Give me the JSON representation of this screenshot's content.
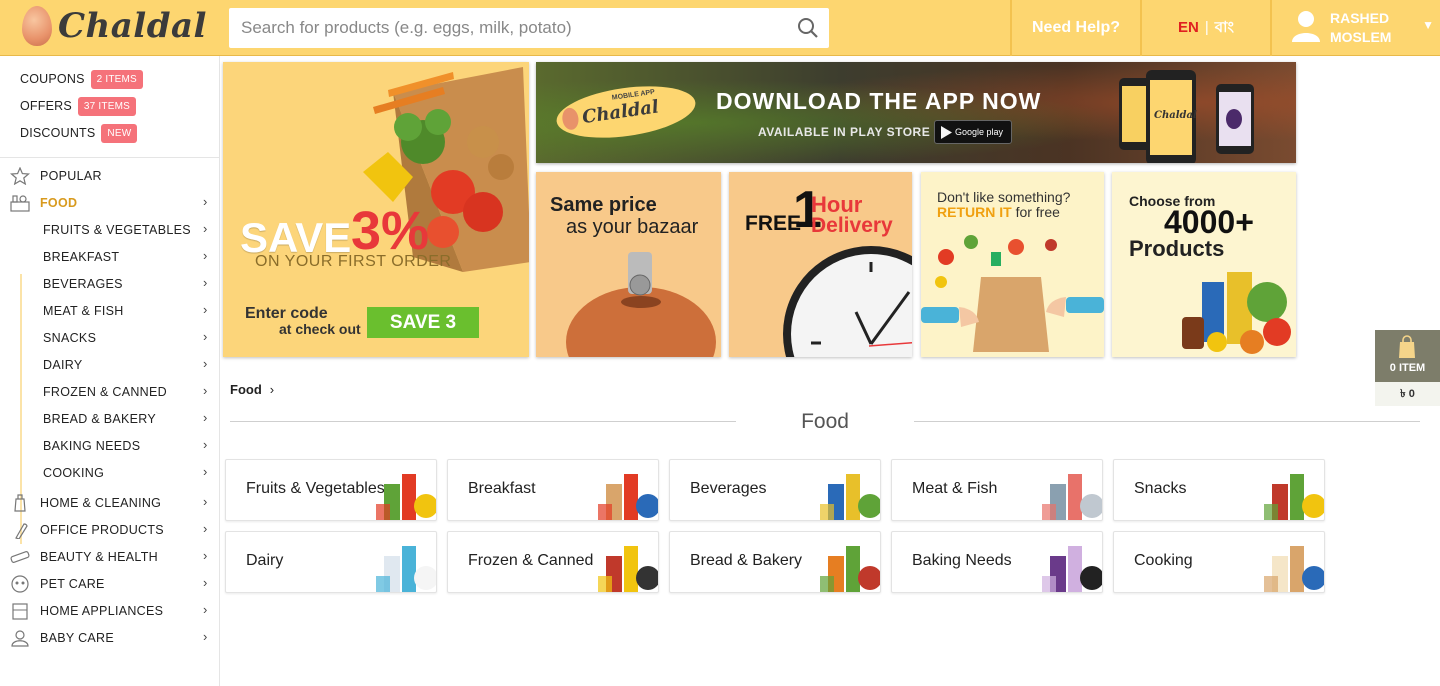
{
  "header": {
    "logo_text": "Chaldal",
    "search_placeholder": "Search for products (e.g. eggs, milk, potato)",
    "help_label": "Need Help?",
    "lang_en": "EN",
    "lang_sep": "|",
    "lang_bn": "বাং",
    "user_first": "RASHED",
    "user_last": "MOSLEM"
  },
  "sidebar": {
    "promos": [
      {
        "label": "COUPONS",
        "badge": "2 ITEMS"
      },
      {
        "label": "OFFERS",
        "badge": "37 ITEMS"
      },
      {
        "label": "DISCOUNTS",
        "badge": "NEW"
      }
    ],
    "popular": "POPULAR",
    "food": "FOOD",
    "food_sub": [
      "FRUITS & VEGETABLES",
      "BREAKFAST",
      "BEVERAGES",
      "MEAT & FISH",
      "SNACKS",
      "DAIRY",
      "FROZEN & CANNED",
      "BREAD & BAKERY",
      "BAKING NEEDS",
      "COOKING"
    ],
    "others": [
      "HOME & CLEANING",
      "OFFICE PRODUCTS",
      "BEAUTY & HEALTH",
      "PET CARE",
      "HOME APPLIANCES",
      "BABY CARE"
    ]
  },
  "banners": {
    "save": {
      "big": "SAVE",
      "pct": "3%",
      "sub": "ON YOUR FIRST ORDER",
      "code_line1": "Enter code",
      "code_line2": "at check out",
      "code": "SAVE 3"
    },
    "app": {
      "badge_top": "MOBILE APP",
      "badge_name": "Chaldal",
      "headline": "DOWNLOAD THE APP NOW",
      "sub": "AVAILABLE IN PLAY STORE",
      "gp": "Google play",
      "phone_logo": "Chaldal"
    },
    "price": {
      "line1": "Same price",
      "line2": "as your bazaar"
    },
    "delivery": {
      "free": "FREE",
      "one": "1",
      "hour": "Hour",
      "delivery": "Delivery"
    },
    "return": {
      "line1": "Don't like something?",
      "ret": "RETURN IT",
      "free": "for free"
    },
    "products": {
      "line1": "Choose from",
      "count": "4000+",
      "line3": "Products"
    }
  },
  "content": {
    "breadcrumb": "Food",
    "breadcrumb_chevron": "›",
    "section_title": "Food",
    "tiles": [
      "Fruits & Vegetables",
      "Breakfast",
      "Beverages",
      "Meat & Fish",
      "Snacks",
      "Dairy",
      "Frozen & Canned",
      "Bread & Bakery",
      "Baking Needs",
      "Cooking"
    ]
  },
  "cart": {
    "items": "0 ITEM",
    "total": "৳ 0"
  },
  "colors": {
    "header_bg": "#fdd670",
    "accent_red": "#e02020",
    "badge": "#f5727a",
    "active": "#d89a1e",
    "code_green": "#6abf2e"
  }
}
